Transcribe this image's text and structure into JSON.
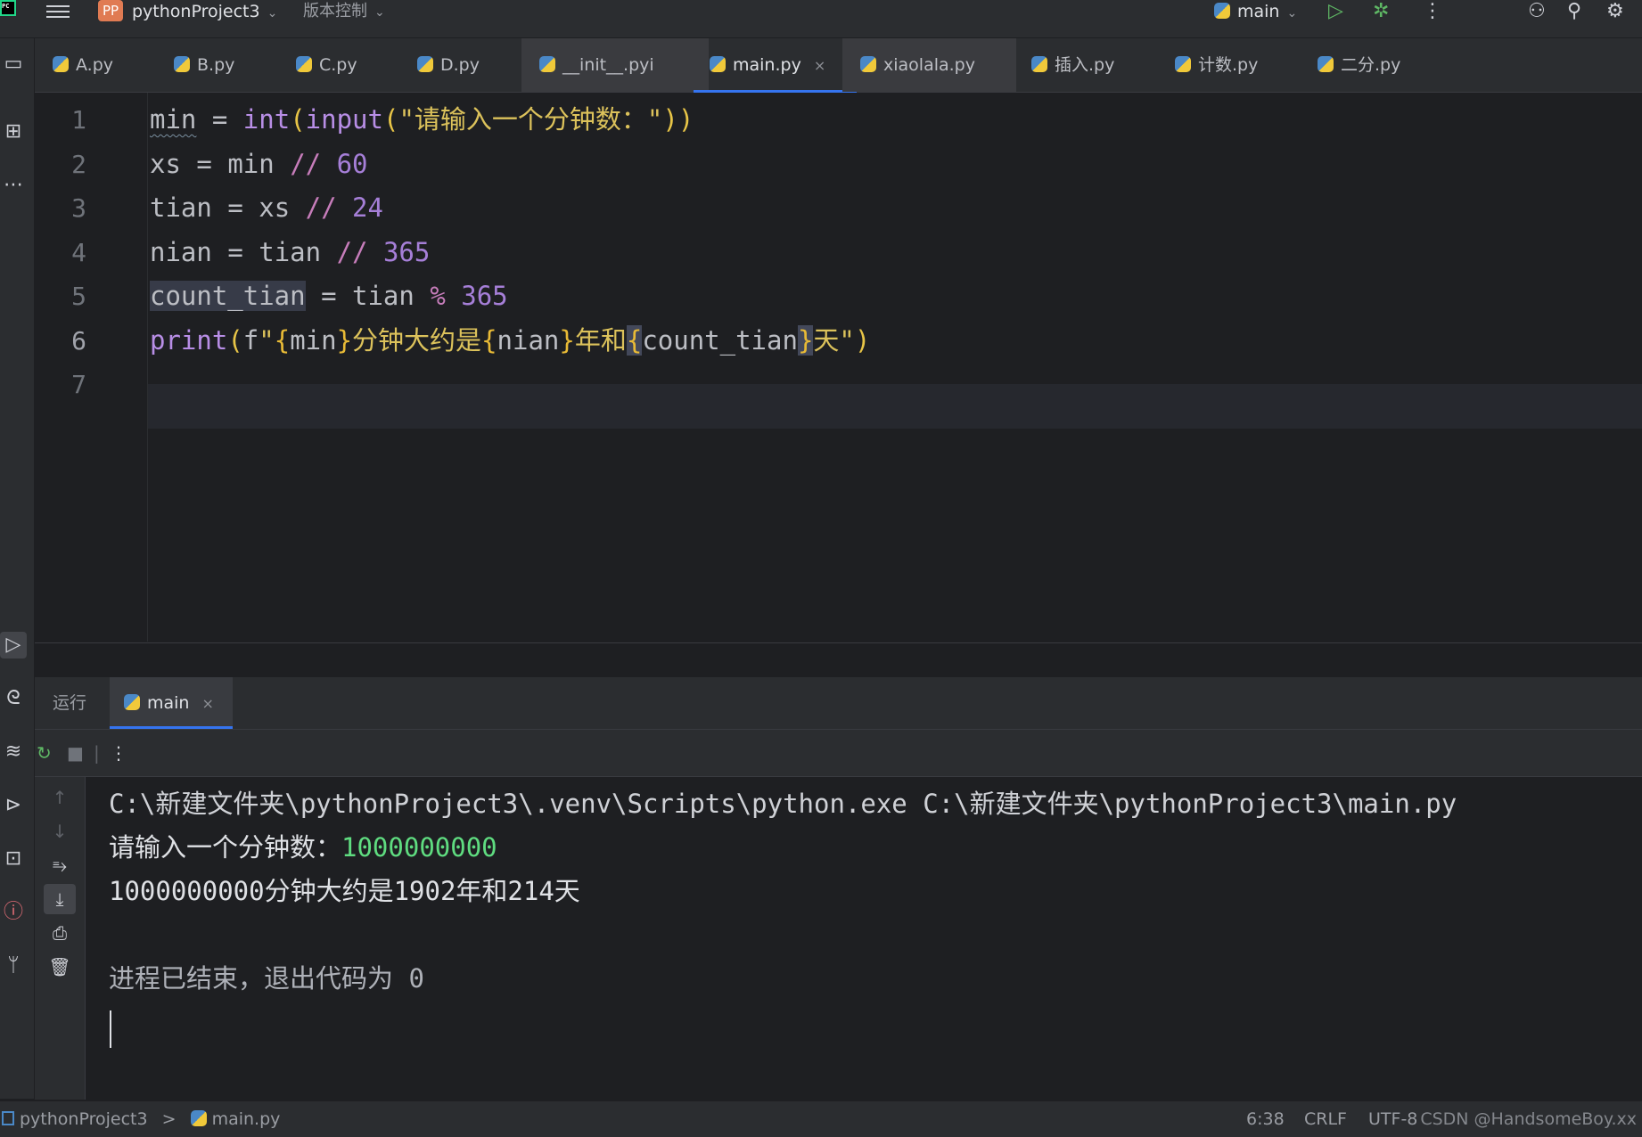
{
  "titlebar": {
    "logo_text": "PC",
    "project_badge": "PP",
    "project_name": "pythonProject3",
    "vcs_label": "版本控制",
    "run_config": "main"
  },
  "tabs": [
    {
      "label": "A.py"
    },
    {
      "label": "B.py"
    },
    {
      "label": "C.py"
    },
    {
      "label": "D.py"
    },
    {
      "label": "__init__.pyi"
    },
    {
      "label": "main.py",
      "active": true,
      "close": "×"
    },
    {
      "label": "xiaolala.py"
    },
    {
      "label": "插入.py"
    },
    {
      "label": "计数.py"
    },
    {
      "label": "二分.py"
    }
  ],
  "editor": {
    "line_numbers": [
      "1",
      "2",
      "3",
      "4",
      "5",
      "6",
      "7"
    ],
    "current_line": 6,
    "lines": [
      "min = int(input(\"请输入一个分钟数：\"))",
      "xs = min // 60",
      "tian = xs // 24",
      "nian = tian // 365",
      "count_tian = tian % 365",
      "print(f\"{min}分钟大约是{nian}年和{count_tian}天\")",
      ""
    ]
  },
  "run_panel": {
    "label": "运行",
    "tab": "main",
    "tab_close": "×",
    "console": {
      "command": "C:\\新建文件夹\\pythonProject3\\.venv\\Scripts\\python.exe C:\\新建文件夹\\pythonProject3\\main.py",
      "prompt": "请输入一个分钟数：",
      "input_value": "1000000000",
      "output": "1000000000分钟大约是1902年和214天",
      "exit_message": "进程已结束，退出代码为 0"
    }
  },
  "statusbar": {
    "project": "pythonProject3",
    "separator": ">",
    "file": "main.py",
    "position": "6:38",
    "line_ending": "CRLF",
    "encoding": "UTF-8",
    "watermark": "CSDN @HandsomeBoy.xx"
  },
  "colors": {
    "accent": "#3574f0",
    "background": "#1e1f22",
    "panel": "#2b2d30",
    "input_green": "#5fdc80",
    "string_yellow": "#dcc25b",
    "number_purple": "#a67fd8",
    "builtin_purple": "#b88ee6"
  }
}
